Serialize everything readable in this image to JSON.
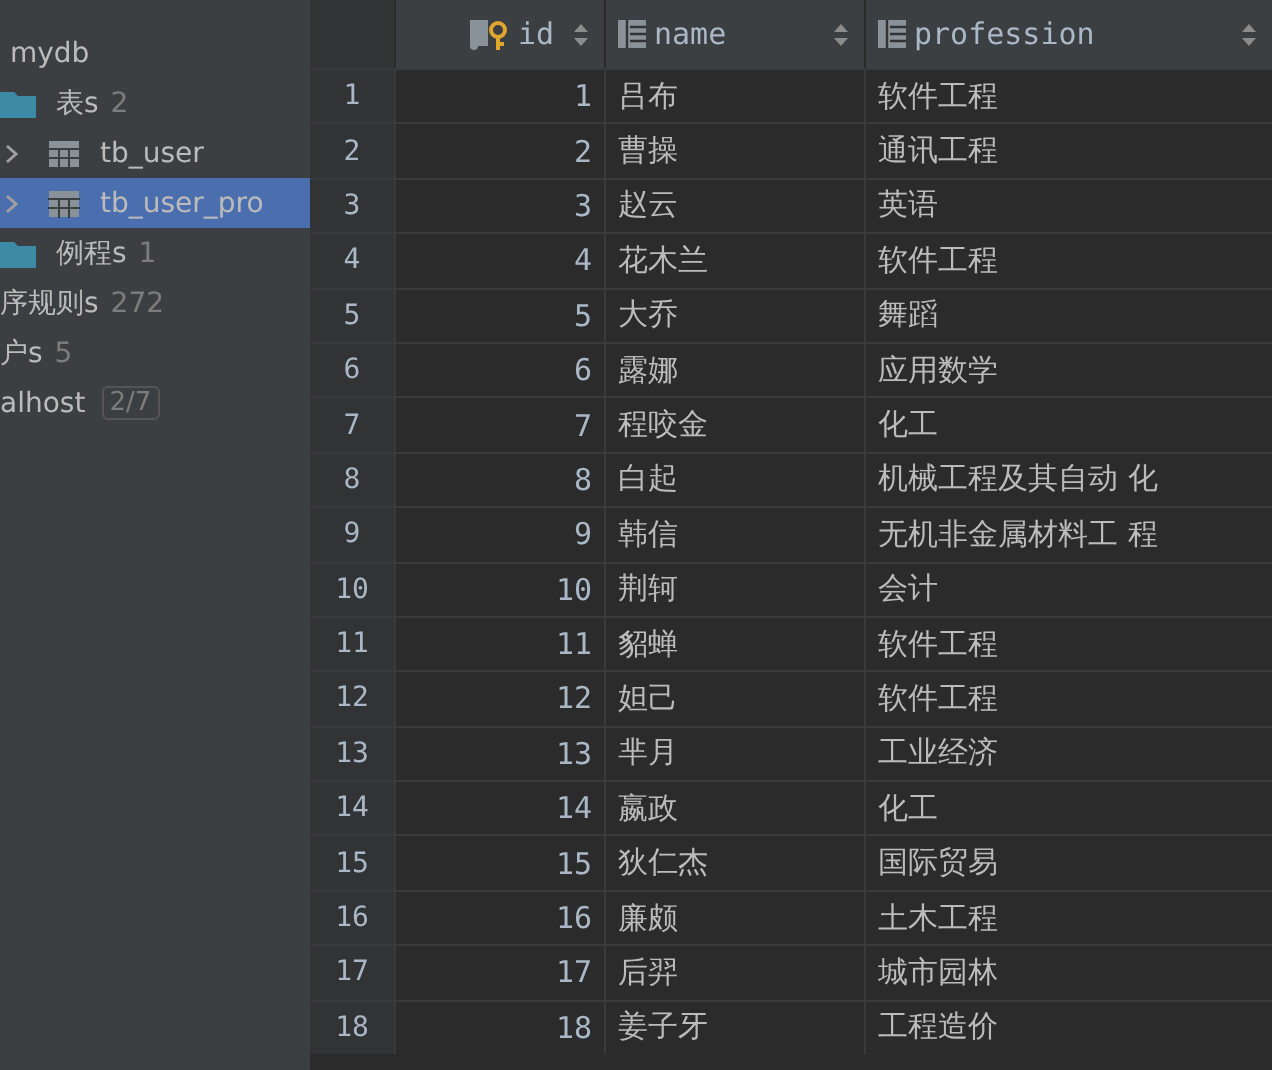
{
  "sidebar": {
    "items": [
      {
        "kind": "schema",
        "label": "mydb",
        "selected": false
      },
      {
        "kind": "folder",
        "label": "表s",
        "count": "2",
        "selected": false
      },
      {
        "kind": "table",
        "label": "tb_user",
        "expanded": false,
        "selected": false
      },
      {
        "kind": "table",
        "label": "tb_user_pro",
        "expanded": false,
        "selected": true
      },
      {
        "kind": "folder",
        "label": "例程s",
        "count": "1",
        "selected": false
      },
      {
        "kind": "group",
        "label": "序规则s",
        "count": "272",
        "selected": false
      },
      {
        "kind": "group",
        "label": "户s",
        "count": "5",
        "selected": false
      },
      {
        "kind": "host",
        "label": "alhost",
        "count": "2/7",
        "selected": false
      }
    ]
  },
  "table": {
    "columns": [
      {
        "label": "id",
        "kind": "key"
      },
      {
        "label": "name",
        "kind": "column"
      },
      {
        "label": "profession",
        "kind": "column"
      }
    ],
    "rows": [
      {
        "num": "1",
        "cells": [
          "1",
          "吕布",
          "软件工程"
        ]
      },
      {
        "num": "2",
        "cells": [
          "2",
          "曹操",
          "通讯工程"
        ]
      },
      {
        "num": "3",
        "cells": [
          "3",
          "赵云",
          "英语"
        ]
      },
      {
        "num": "4",
        "cells": [
          "4",
          "花木兰",
          "软件工程"
        ]
      },
      {
        "num": "5",
        "cells": [
          "5",
          "大乔",
          "舞蹈"
        ]
      },
      {
        "num": "6",
        "cells": [
          "6",
          "露娜",
          "应用数学"
        ]
      },
      {
        "num": "7",
        "cells": [
          "7",
          "程咬金",
          "化工"
        ]
      },
      {
        "num": "8",
        "cells": [
          "8",
          "白起",
          "机械工程及其自动 化"
        ]
      },
      {
        "num": "9",
        "cells": [
          "9",
          "韩信",
          "无机非金属材料工 程"
        ]
      },
      {
        "num": "10",
        "cells": [
          "10",
          "荆轲",
          "会计"
        ]
      },
      {
        "num": "11",
        "cells": [
          "11",
          "貂蝉",
          "软件工程"
        ]
      },
      {
        "num": "12",
        "cells": [
          "12",
          "妲己",
          "软件工程"
        ]
      },
      {
        "num": "13",
        "cells": [
          "13",
          "芈月",
          "工业经济"
        ]
      },
      {
        "num": "14",
        "cells": [
          "14",
          "嬴政",
          "化工"
        ]
      },
      {
        "num": "15",
        "cells": [
          "15",
          "狄仁杰",
          "国际贸易"
        ]
      },
      {
        "num": "16",
        "cells": [
          "16",
          "廉颇",
          "土木工程"
        ]
      },
      {
        "num": "17",
        "cells": [
          "17",
          "后羿",
          "城市园林"
        ]
      },
      {
        "num": "18",
        "cells": [
          "18",
          "姜子牙",
          "工程造价"
        ]
      }
    ]
  }
}
